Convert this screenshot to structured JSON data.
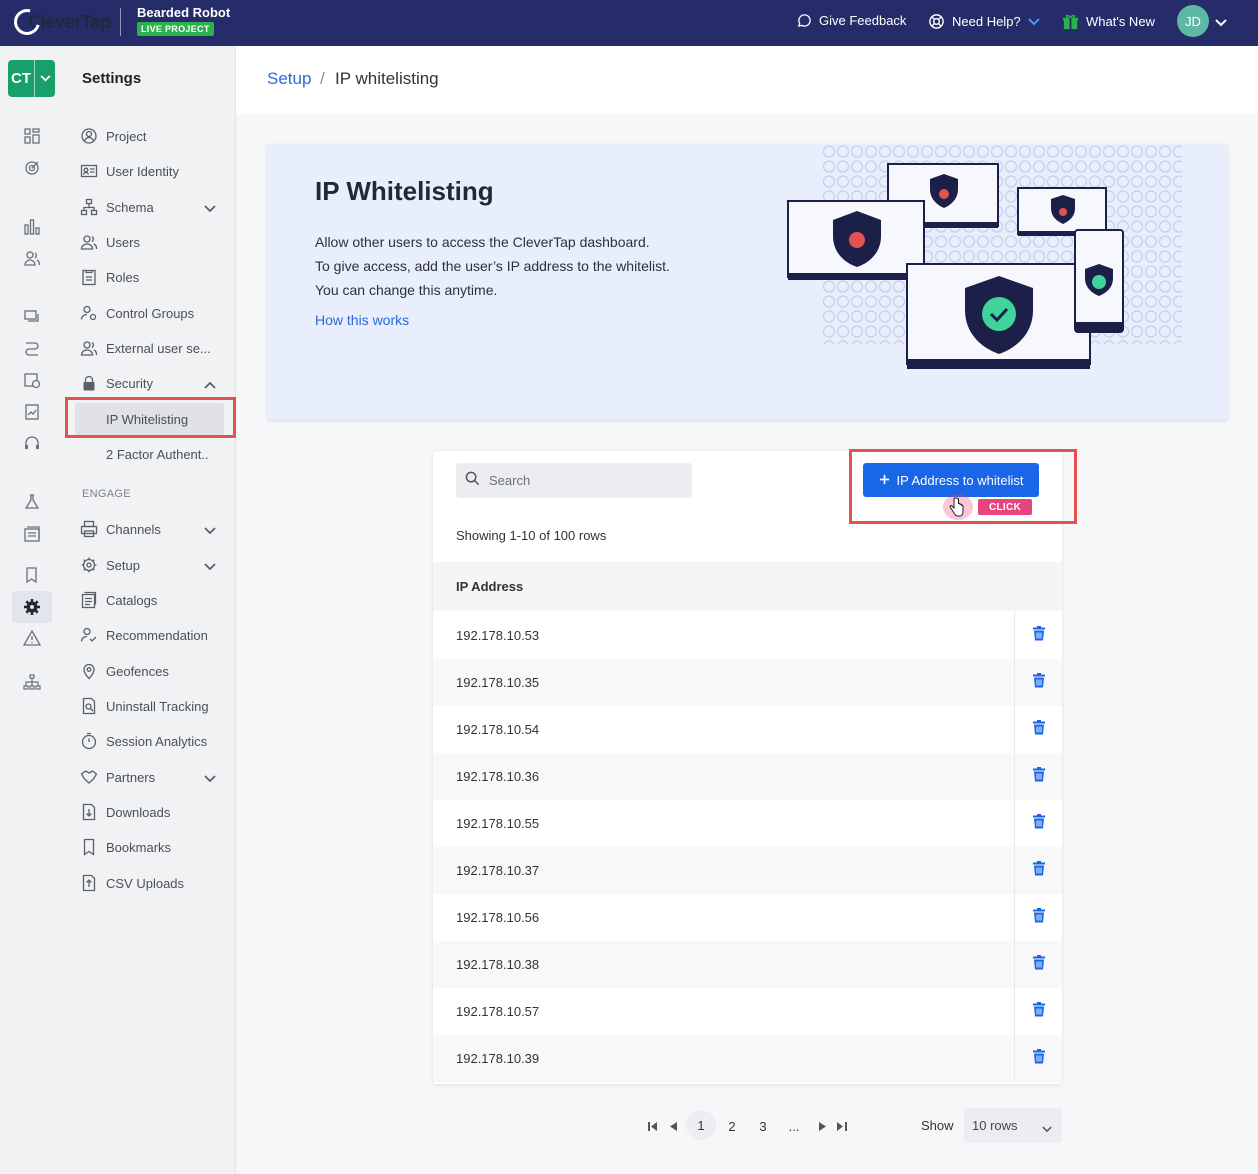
{
  "brand": {
    "logo_text": "CleverTap",
    "project_name": "Bearded Robot",
    "project_badge": "LIVE PROJECT"
  },
  "topbar": {
    "feedback": "Give Feedback",
    "help": "Need Help?",
    "whats_new": "What's New",
    "avatar": "JD"
  },
  "rail": {
    "app_switcher": "CT"
  },
  "sidebar": {
    "title": "Settings",
    "items": [
      {
        "label": "Project",
        "icon": "user-circle-icon"
      },
      {
        "label": "User Identity",
        "icon": "id-card-icon"
      },
      {
        "label": "Schema",
        "icon": "hierarchy-icon"
      },
      {
        "label": "Users",
        "icon": "users-icon"
      },
      {
        "label": "Roles",
        "icon": "clipboard-icon"
      },
      {
        "label": "Control Groups",
        "icon": "user-gear-icon"
      },
      {
        "label": "External user se...",
        "icon": "users-icon"
      },
      {
        "label": "Security",
        "icon": "lock-icon"
      },
      {
        "label": "IP Whitelisting"
      },
      {
        "label": "2 Factor Authent.."
      }
    ],
    "section_label": "ENGAGE",
    "engage_items": [
      {
        "label": "Channels",
        "icon": "printer-icon"
      },
      {
        "label": "Setup",
        "icon": "gear-icon"
      },
      {
        "label": "Catalogs",
        "icon": "catalog-icon"
      },
      {
        "label": "Recommendation",
        "icon": "user-check-icon"
      },
      {
        "label": "Geofences",
        "icon": "map-pin-icon"
      },
      {
        "label": "Uninstall Tracking",
        "icon": "search-doc-icon"
      },
      {
        "label": "Session Analytics",
        "icon": "stopwatch-icon"
      },
      {
        "label": "Partners",
        "icon": "handshake-icon"
      },
      {
        "label": "Downloads",
        "icon": "download-icon"
      },
      {
        "label": "Bookmarks",
        "icon": "bookmark-icon"
      },
      {
        "label": "CSV Uploads",
        "icon": "upload-icon"
      }
    ]
  },
  "breadcrumb": {
    "parent": "Setup",
    "separator": "/",
    "current": "IP whitelisting"
  },
  "hero": {
    "title": "IP Whitelisting",
    "lines": [
      "Allow other users to access the CleverTap dashboard.",
      "To give access, add the user’s IP address to the whitelist.",
      "You can change this anytime."
    ],
    "link": "How this works"
  },
  "table": {
    "search_placeholder": "Search",
    "add_button": "IP Address to whitelist",
    "click_badge": "CLICK",
    "rows_info": "Showing 1-10 of 100 rows",
    "column_header": "IP Address",
    "rows": [
      "192.178.10.53",
      "192.178.10.35",
      "192.178.10.54",
      "192.178.10.36",
      "192.178.10.55",
      "192.178.10.37",
      "192.178.10.56",
      "192.178.10.38",
      "192.178.10.57",
      "192.178.10.39"
    ]
  },
  "pagination": {
    "pages": [
      "1",
      "2",
      "3",
      "..."
    ],
    "current": "1",
    "show_label": "Show",
    "rows_option": "10 rows"
  },
  "colors": {
    "topbar": "#262c6a",
    "accent": "#1a66e8",
    "brand_green": "#17a06a",
    "highlight_red": "#e4524f",
    "click_pink": "#e8457e",
    "delete_blue": "#1a66e8"
  }
}
